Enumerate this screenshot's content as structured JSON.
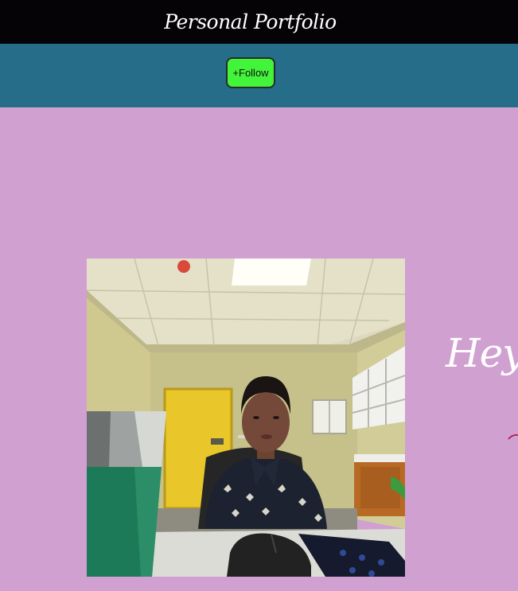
{
  "header": {
    "brand": "Personal Portfolio"
  },
  "actions": {
    "follow_label": "+Follow"
  },
  "hero": {
    "greeting": "Hey",
    "photo_alt": "profile photo"
  },
  "colors": {
    "header_bg": "#050305",
    "action_bar_bg": "#266d8a",
    "follow_button_bg": "#43f53a",
    "page_bg": "#d0a0d0",
    "greeting_color": "#ffffff"
  }
}
